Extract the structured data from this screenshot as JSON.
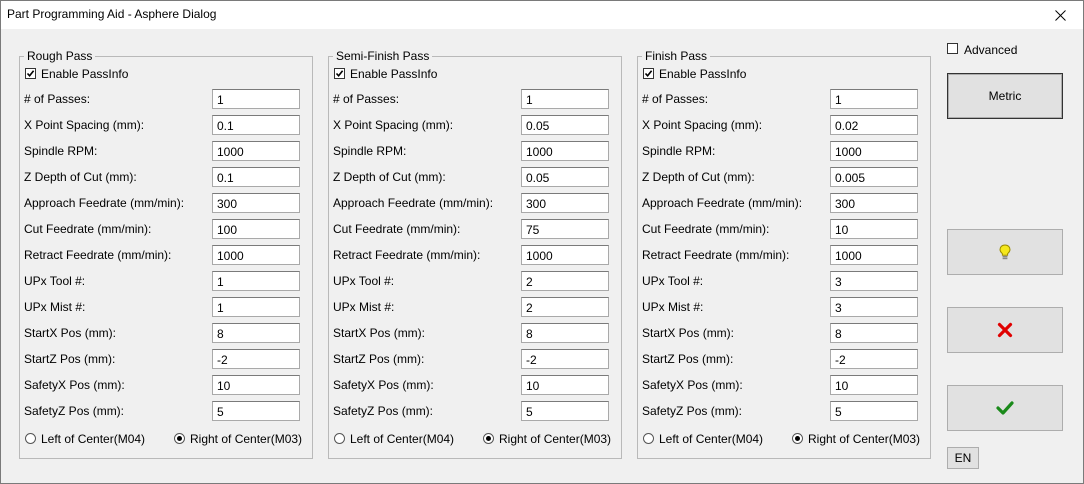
{
  "window": {
    "title": "Part Programming Aid - Asphere Dialog"
  },
  "field_labels": [
    "# of Passes:",
    "X Point Spacing (mm):",
    "Spindle RPM:",
    "Z Depth of Cut (mm):",
    "Approach Feedrate (mm/min):",
    "Cut Feedrate (mm/min):",
    "Retract Feedrate (mm/min):",
    "UPx Tool #:",
    "UPx Mist #:",
    "StartX Pos (mm):",
    "StartZ Pos (mm):",
    "SafetyX Pos (mm):",
    "SafetyZ Pos (mm):"
  ],
  "enable_label": "Enable PassInfo",
  "left_radio_label": "Left of Center(M04)",
  "right_radio_label": "Right of Center(M03)",
  "passes": [
    {
      "title": "Rough Pass",
      "enabled": true,
      "values": [
        "1",
        "0.1",
        "1000",
        "0.1",
        "300",
        "100",
        "1000",
        "1",
        "1",
        "8",
        "-2",
        "10",
        "5"
      ],
      "direction": "right"
    },
    {
      "title": "Semi-Finish Pass",
      "enabled": true,
      "values": [
        "1",
        "0.05",
        "1000",
        "0.05",
        "300",
        "75",
        "1000",
        "2",
        "2",
        "8",
        "-2",
        "10",
        "5"
      ],
      "direction": "right"
    },
    {
      "title": "Finish Pass",
      "enabled": true,
      "values": [
        "1",
        "0.02",
        "1000",
        "0.005",
        "300",
        "10",
        "1000",
        "3",
        "3",
        "8",
        "-2",
        "10",
        "5"
      ],
      "direction": "right"
    }
  ],
  "advanced": {
    "label": "Advanced",
    "checked": false
  },
  "buttons": {
    "metric_label": "Metric",
    "help_icon": "lightbulb-icon",
    "cancel_icon": "red-x-icon",
    "ok_icon": "green-check-icon",
    "lang_label": "EN"
  },
  "colors": {
    "help_icon": "#e6d400",
    "cancel_icon": "#e00000",
    "ok_icon": "#1a8a1a"
  }
}
